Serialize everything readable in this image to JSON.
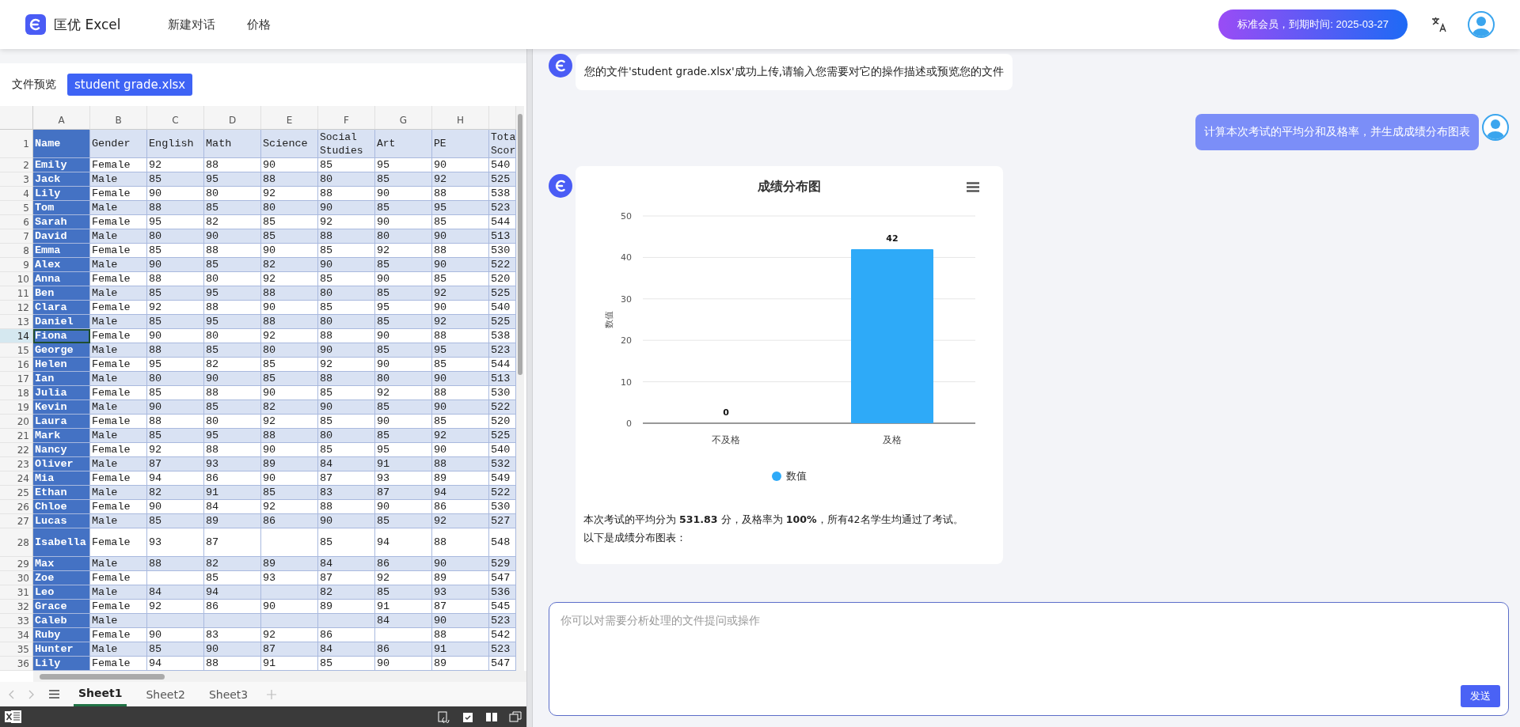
{
  "header": {
    "logo_text": "匡优 Excel",
    "nav": [
      {
        "label": "新建对话"
      },
      {
        "label": "价格"
      }
    ],
    "membership": "标准会员，到期时间: 2025-03-27"
  },
  "preview": {
    "label": "文件预览",
    "file": "student grade.xlsx"
  },
  "sheet": {
    "columns": [
      "A",
      "B",
      "C",
      "D",
      "E",
      "F",
      "G",
      "H"
    ],
    "rows": [
      {
        "n": "1",
        "tall": true,
        "selected": false,
        "cells": [
          "Name",
          "Gender",
          "English",
          "Math",
          "Science",
          "Social Studies",
          "Art",
          "PE",
          "Tota Scor"
        ]
      },
      {
        "n": "2",
        "tall": false,
        "selected": false,
        "cells": [
          "Emily",
          "Female",
          "92",
          "88",
          "90",
          "85",
          "95",
          "90",
          "540"
        ]
      },
      {
        "n": "3",
        "tall": false,
        "selected": false,
        "cells": [
          "Jack",
          "Male",
          "85",
          "95",
          "88",
          "80",
          "85",
          "92",
          "525"
        ]
      },
      {
        "n": "4",
        "tall": false,
        "selected": false,
        "cells": [
          "Lily",
          "Female",
          "90",
          "80",
          "92",
          "88",
          "90",
          "88",
          "538"
        ]
      },
      {
        "n": "5",
        "tall": false,
        "selected": false,
        "cells": [
          "Tom",
          "Male",
          "88",
          "85",
          "80",
          "90",
          "85",
          "95",
          "523"
        ]
      },
      {
        "n": "6",
        "tall": false,
        "selected": false,
        "cells": [
          "Sarah",
          "Female",
          "95",
          "82",
          "85",
          "92",
          "90",
          "85",
          "544"
        ]
      },
      {
        "n": "7",
        "tall": false,
        "selected": false,
        "cells": [
          "David",
          "Male",
          "80",
          "90",
          "85",
          "88",
          "80",
          "90",
          "513"
        ]
      },
      {
        "n": "8",
        "tall": false,
        "selected": false,
        "cells": [
          "Emma",
          "Female",
          "85",
          "88",
          "90",
          "85",
          "92",
          "88",
          "530"
        ]
      },
      {
        "n": "9",
        "tall": false,
        "selected": false,
        "cells": [
          "Alex",
          "Male",
          "90",
          "85",
          "82",
          "90",
          "85",
          "90",
          "522"
        ]
      },
      {
        "n": "10",
        "tall": false,
        "selected": false,
        "cells": [
          "Anna",
          "Female",
          "88",
          "80",
          "92",
          "85",
          "90",
          "85",
          "520"
        ]
      },
      {
        "n": "11",
        "tall": false,
        "selected": false,
        "cells": [
          "Ben",
          "Male",
          "85",
          "95",
          "88",
          "80",
          "85",
          "92",
          "525"
        ]
      },
      {
        "n": "12",
        "tall": false,
        "selected": false,
        "cells": [
          "Clara",
          "Female",
          "92",
          "88",
          "90",
          "85",
          "95",
          "90",
          "540"
        ]
      },
      {
        "n": "13",
        "tall": false,
        "selected": false,
        "cells": [
          "Daniel",
          "Male",
          "85",
          "95",
          "88",
          "80",
          "85",
          "92",
          "525"
        ]
      },
      {
        "n": "14",
        "tall": false,
        "selected": true,
        "cells": [
          "Fiona",
          "Female",
          "90",
          "80",
          "92",
          "88",
          "90",
          "88",
          "538"
        ]
      },
      {
        "n": "15",
        "tall": false,
        "selected": false,
        "cells": [
          "George",
          "Male",
          "88",
          "85",
          "80",
          "90",
          "85",
          "95",
          "523"
        ]
      },
      {
        "n": "16",
        "tall": false,
        "selected": false,
        "cells": [
          "Helen",
          "Female",
          "95",
          "82",
          "85",
          "92",
          "90",
          "85",
          "544"
        ]
      },
      {
        "n": "17",
        "tall": false,
        "selected": false,
        "cells": [
          "Ian",
          "Male",
          "80",
          "90",
          "85",
          "88",
          "80",
          "90",
          "513"
        ]
      },
      {
        "n": "18",
        "tall": false,
        "selected": false,
        "cells": [
          "Julia",
          "Female",
          "85",
          "88",
          "90",
          "85",
          "92",
          "88",
          "530"
        ]
      },
      {
        "n": "19",
        "tall": false,
        "selected": false,
        "cells": [
          "Kevin",
          "Male",
          "90",
          "85",
          "82",
          "90",
          "85",
          "90",
          "522"
        ]
      },
      {
        "n": "20",
        "tall": false,
        "selected": false,
        "cells": [
          "Laura",
          "Female",
          "88",
          "80",
          "92",
          "85",
          "90",
          "85",
          "520"
        ]
      },
      {
        "n": "21",
        "tall": false,
        "selected": false,
        "cells": [
          "Mark",
          "Male",
          "85",
          "95",
          "88",
          "80",
          "85",
          "92",
          "525"
        ]
      },
      {
        "n": "22",
        "tall": false,
        "selected": false,
        "cells": [
          "Nancy",
          "Female",
          "92",
          "88",
          "90",
          "85",
          "95",
          "90",
          "540"
        ]
      },
      {
        "n": "23",
        "tall": false,
        "selected": false,
        "cells": [
          "Oliver",
          "Male",
          "87",
          "93",
          "89",
          "84",
          "91",
          "88",
          "532"
        ]
      },
      {
        "n": "24",
        "tall": false,
        "selected": false,
        "cells": [
          "Mia",
          "Female",
          "94",
          "86",
          "90",
          "87",
          "93",
          "89",
          "549"
        ]
      },
      {
        "n": "25",
        "tall": false,
        "selected": false,
        "cells": [
          "Ethan",
          "Male",
          "82",
          "91",
          "85",
          "83",
          "87",
          "94",
          "522"
        ]
      },
      {
        "n": "26",
        "tall": false,
        "selected": false,
        "cells": [
          "Chloe",
          "Female",
          "90",
          "84",
          "92",
          "88",
          "90",
          "86",
          "530"
        ]
      },
      {
        "n": "27",
        "tall": false,
        "selected": false,
        "cells": [
          "Lucas",
          "Male",
          "85",
          "89",
          "86",
          "90",
          "85",
          "92",
          "527"
        ]
      },
      {
        "n": "28",
        "tall": true,
        "selected": false,
        "cells": [
          "Isabella",
          "Female",
          "93",
          "87",
          null,
          "85",
          "94",
          "88",
          "548"
        ]
      },
      {
        "n": "29",
        "tall": false,
        "selected": false,
        "cells": [
          "Max",
          "Male",
          "88",
          "82",
          "89",
          "84",
          "86",
          "90",
          "529"
        ]
      },
      {
        "n": "30",
        "tall": false,
        "selected": false,
        "cells": [
          "Zoe",
          "Female",
          null,
          "85",
          "93",
          "87",
          "92",
          "89",
          "547"
        ]
      },
      {
        "n": "31",
        "tall": false,
        "selected": false,
        "cells": [
          "Leo",
          "Male",
          "84",
          "94",
          null,
          "82",
          "85",
          "93",
          "536"
        ]
      },
      {
        "n": "32",
        "tall": false,
        "selected": false,
        "cells": [
          "Grace",
          "Female",
          "92",
          "86",
          "90",
          "89",
          "91",
          "87",
          "545"
        ]
      },
      {
        "n": "33",
        "tall": false,
        "selected": false,
        "cells": [
          "Caleb",
          "Male",
          null,
          null,
          null,
          null,
          "84",
          "90",
          "523"
        ]
      },
      {
        "n": "34",
        "tall": false,
        "selected": false,
        "cells": [
          "Ruby",
          "Female",
          "90",
          "83",
          "92",
          "86",
          null,
          "88",
          "542"
        ]
      },
      {
        "n": "35",
        "tall": false,
        "selected": false,
        "cells": [
          "Hunter",
          "Male",
          "85",
          "90",
          "87",
          "84",
          "86",
          "91",
          "523"
        ]
      },
      {
        "n": "36",
        "tall": false,
        "selected": false,
        "cells": [
          "Lily",
          "Female",
          "94",
          "88",
          "91",
          "85",
          "90",
          "89",
          "547"
        ]
      }
    ],
    "tabs": [
      {
        "label": "Sheet1",
        "selected": true
      },
      {
        "label": "Sheet2",
        "selected": false
      },
      {
        "label": "Sheet3",
        "selected": false
      }
    ]
  },
  "chat": {
    "messages": [
      {
        "kind": "bot",
        "text": "您的文件'student grade.xlsx'成功上传,请输入您需要对它的操作描述或预览您的文件"
      },
      {
        "kind": "user",
        "text": "计算本次考试的平均分和及格率，并生成成绩分布图表"
      },
      {
        "kind": "chart",
        "chart_data": {
          "type": "bar",
          "title": "成绩分布图",
          "ylabel": "数值",
          "categories": [
            "不及格",
            "及格"
          ],
          "series": [
            {
              "name": "数值",
              "color": "#2eaaf8",
              "values": [
                0,
                42
              ]
            }
          ],
          "grid": true,
          "ylim": [
            0,
            50
          ],
          "yticks": [
            0,
            10,
            20,
            30,
            40,
            50
          ],
          "data_labels": true
        },
        "lines": [
          "本次考试的平均分为 **531.83** 分，及格率为 **100%**，所有42名学生均通过了考试。",
          "以下是成绩分布图表："
        ]
      }
    ],
    "input": {
      "placeholder": "你可以对需要分析处理的文件提问或操作",
      "send": "发送"
    }
  }
}
